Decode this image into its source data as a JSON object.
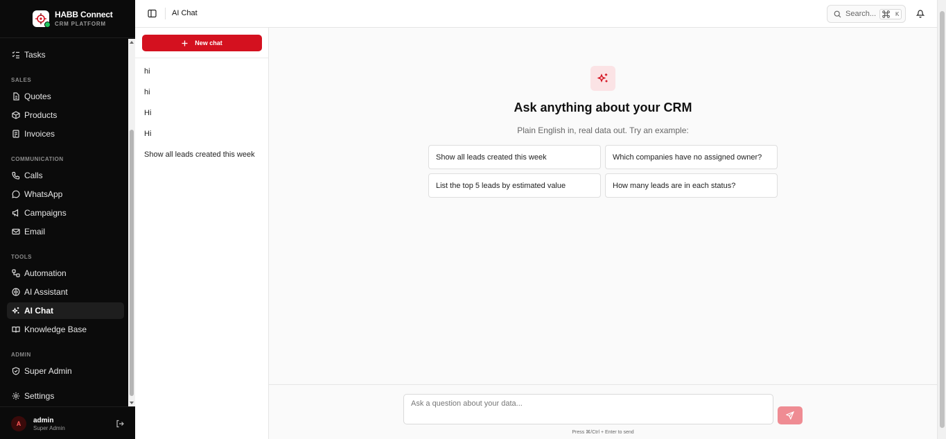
{
  "brand": {
    "name": "HABB Connect",
    "subtitle": "CRM PLATFORM"
  },
  "nav": {
    "items": [
      {
        "label": "Tasks",
        "icon": "tasks-icon"
      },
      {
        "section": "SALES"
      },
      {
        "label": "Quotes",
        "icon": "file-icon"
      },
      {
        "label": "Products",
        "icon": "box-icon"
      },
      {
        "label": "Invoices",
        "icon": "receipt-icon"
      },
      {
        "section": "COMMUNICATION"
      },
      {
        "label": "Calls",
        "icon": "phone-icon"
      },
      {
        "label": "WhatsApp",
        "icon": "message-icon"
      },
      {
        "label": "Campaigns",
        "icon": "megaphone-icon"
      },
      {
        "label": "Email",
        "icon": "mail-icon"
      },
      {
        "section": "TOOLS"
      },
      {
        "label": "Automation",
        "icon": "workflow-icon"
      },
      {
        "label": "AI Assistant",
        "icon": "brain-icon"
      },
      {
        "label": "AI Chat",
        "icon": "sparkles-icon",
        "active": true
      },
      {
        "label": "Knowledge Base",
        "icon": "book-icon"
      },
      {
        "section": "ADMIN"
      },
      {
        "label": "Super Admin",
        "icon": "shield-icon"
      },
      {
        "label": "Settings",
        "icon": "gear-icon"
      }
    ]
  },
  "user": {
    "initial": "A",
    "name": "admin",
    "role": "Super Admin"
  },
  "topbar": {
    "title": "AI Chat",
    "search_label": "Search...",
    "shortcut_key": "K"
  },
  "chatlist": {
    "new_chat_label": "New chat",
    "chats": [
      "hi",
      "hi",
      "Hi",
      "Hi",
      "Show all leads created this week"
    ]
  },
  "main": {
    "title": "Ask anything about your CRM",
    "subtitle": "Plain English in, real data out. Try an example:",
    "suggestions": [
      "Show all leads created this week",
      "Which companies have no assigned owner?",
      "List the top 5 leads by estimated value",
      "How many leads are in each status?"
    ]
  },
  "composer": {
    "placeholder": "Ask a question about your data...",
    "hint": "Press ⌘/Ctrl + Enter to send"
  },
  "colors": {
    "accent": "#d4111f",
    "sidebar_bg": "#0b0b0b",
    "send_disabled": "#ef8c93",
    "online": "#22c55e"
  }
}
